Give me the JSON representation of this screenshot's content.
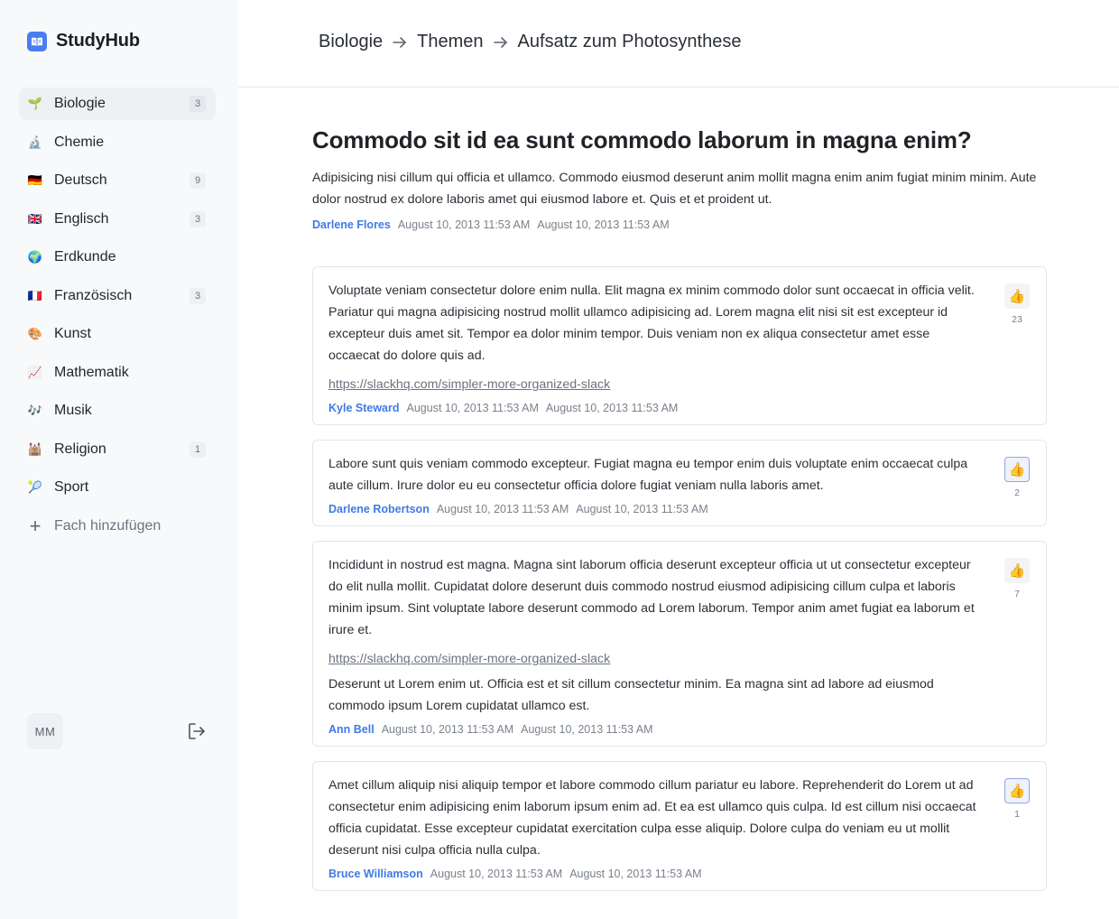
{
  "app": {
    "name": "StudyHub"
  },
  "sidebar": {
    "items": [
      {
        "label": "Biologie",
        "icon": "🌱",
        "icon_name": "seedling-icon",
        "badge": "3",
        "active": true
      },
      {
        "label": "Chemie",
        "icon": "🔬",
        "icon_name": "microscope-icon",
        "badge": ""
      },
      {
        "label": "Deutsch",
        "icon": "🇩🇪",
        "icon_name": "german-flag-icon",
        "badge": "9"
      },
      {
        "label": "Englisch",
        "icon": "🇬🇧",
        "icon_name": "uk-flag-icon",
        "badge": "3"
      },
      {
        "label": "Erdkunde",
        "icon": "🌍",
        "icon_name": "globe-icon",
        "badge": ""
      },
      {
        "label": "Französisch",
        "icon": "🇫🇷",
        "icon_name": "french-flag-icon",
        "badge": "3"
      },
      {
        "label": "Kunst",
        "icon": "🎨",
        "icon_name": "palette-icon",
        "badge": ""
      },
      {
        "label": "Mathematik",
        "icon": "📈",
        "icon_name": "chart-icon",
        "badge": ""
      },
      {
        "label": "Musik",
        "icon": "🎶",
        "icon_name": "music-notes-icon",
        "badge": ""
      },
      {
        "label": "Religion",
        "icon": "🕍",
        "icon_name": "temple-icon",
        "badge": "1"
      },
      {
        "label": "Sport",
        "icon": "🎾",
        "icon_name": "tennis-ball-icon",
        "badge": ""
      }
    ],
    "add_label": "Fach hinzufügen",
    "user_initials": "MM"
  },
  "breadcrumb": [
    "Biologie",
    "Themen",
    "Aufsatz zum Photosynthese"
  ],
  "question": {
    "title": "Commodo sit id ea sunt commodo laborum in magna enim?",
    "body": "Adipisicing nisi cillum qui officia et ullamco. Commodo eiusmod deserunt anim mollit magna enim anim fugiat minim minim. Aute dolor nostrud ex dolore laboris amet qui eiusmod labore et. Quis et et proident ut.",
    "author": "Darlene Flores",
    "created": "August 10, 2013 11:53 AM",
    "updated": "August 10, 2013 11:53 AM"
  },
  "answers": [
    {
      "text": "Voluptate veniam consectetur dolore enim nulla. Elit magna ex minim commodo dolor sunt occaecat in officia velit. Pariatur qui magna adipisicing nostrud mollit ullamco adipisicing ad. Lorem magna elit nisi sit est excepteur id excepteur duis amet sit. Tempor ea dolor minim tempor. Duis veniam non ex aliqua consectetur amet esse occaecat do dolore quis ad.",
      "link": "https://slackhq.com/simpler-more-organized-slack",
      "extra": "",
      "author": "Kyle Steward",
      "created": "August 10, 2013 11:53 AM",
      "updated": "August 10, 2013 11:53 AM",
      "likes": "23",
      "liked": false
    },
    {
      "text": "Labore sunt quis veniam commodo excepteur. Fugiat magna eu tempor enim duis voluptate enim occaecat culpa aute cillum. Irure dolor eu eu consectetur officia dolore fugiat veniam nulla laboris amet.",
      "link": "",
      "extra": "",
      "author": "Darlene Robertson",
      "created": "August 10, 2013 11:53 AM",
      "updated": "August 10, 2013 11:53 AM",
      "likes": "2",
      "liked": true
    },
    {
      "text": "Incididunt in nostrud est magna. Magna sint laborum officia deserunt excepteur officia ut ut consectetur excepteur do elit nulla mollit. Cupidatat dolore deserunt duis commodo nostrud eiusmod adipisicing cillum culpa et laboris minim ipsum. Sint voluptate labore deserunt commodo ad Lorem laborum. Tempor anim amet fugiat ea laborum et irure et.",
      "link": "https://slackhq.com/simpler-more-organized-slack",
      "extra": "Deserunt ut Lorem enim ut. Officia est et sit cillum consectetur minim. Ea magna sint ad labore ad eiusmod commodo ipsum Lorem cupidatat ullamco est.",
      "author": "Ann Bell",
      "created": "August 10, 2013 11:53 AM",
      "updated": "August 10, 2013 11:53 AM",
      "likes": "7",
      "liked": false
    },
    {
      "text": "Amet cillum aliquip nisi aliquip tempor et labore commodo cillum pariatur eu labore. Reprehenderit do Lorem ut ad consectetur enim adipisicing enim laborum ipsum enim ad. Et ea est ullamco quis culpa. Id est cillum nisi occaecat officia cupidatat. Esse excepteur cupidatat exercitation culpa esse aliquip. Dolore culpa do veniam eu ut mollit deserunt nisi culpa officia nulla culpa.",
      "link": "",
      "extra": "",
      "author": "Bruce Williamson",
      "created": "August 10, 2013 11:53 AM",
      "updated": "August 10, 2013 11:53 AM",
      "likes": "1",
      "liked": true
    }
  ],
  "colors": {
    "accent": "#3f7ae6",
    "brand": "#4a7ef0"
  }
}
